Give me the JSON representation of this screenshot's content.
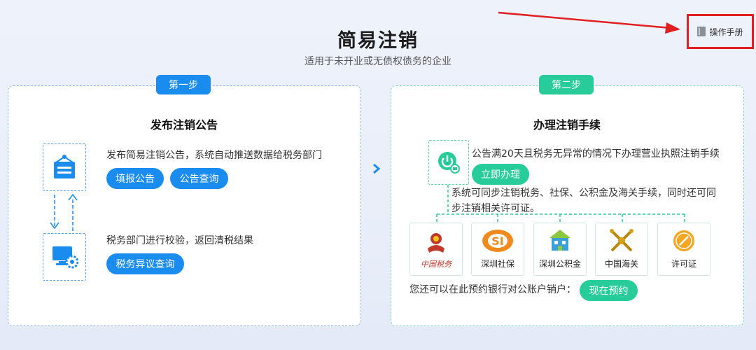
{
  "header": {
    "title": "简易注销",
    "subtitle": "适用于未开业或无债权债务的企业",
    "manual_label": "操作手册"
  },
  "step1": {
    "badge": "第一步",
    "heading": "发布注销公告",
    "announce_text": "发布简易注销公告，系统自动推送数据给税务部门",
    "fill_button": "填报公告",
    "query_button": "公告查询",
    "verify_text": "税务部门进行校验，返回清税结果",
    "objection_button": "税务异议查询"
  },
  "step2": {
    "badge": "第二步",
    "heading": "办理注销手续",
    "condition_text": "公告满20天且税务无异常的情况下办理营业执照注销手续",
    "handle_button": "立即办理",
    "sync_text_1": "系统可同步注销税务、社保、公积金及海关手续，同时还可同",
    "sync_text_2": "步注销相关许可证。",
    "logos": [
      {
        "label": "",
        "icon": "tax-emblem-icon"
      },
      {
        "label": "深圳社保",
        "icon": "social-security-logo-icon"
      },
      {
        "label": "深圳公积金",
        "icon": "housing-fund-logo-icon"
      },
      {
        "label": "中国海关",
        "icon": "customs-emblem-icon"
      },
      {
        "label": "许可证",
        "icon": "license-icon"
      }
    ],
    "tax_logo_text": "中国税务",
    "bank_text": "您还可以在此预约银行对公账户销户：",
    "reserve_button": "现在预约"
  },
  "colors": {
    "blue": "#1a8cf0",
    "green": "#27cc9a",
    "annotation_red": "#e02020"
  }
}
